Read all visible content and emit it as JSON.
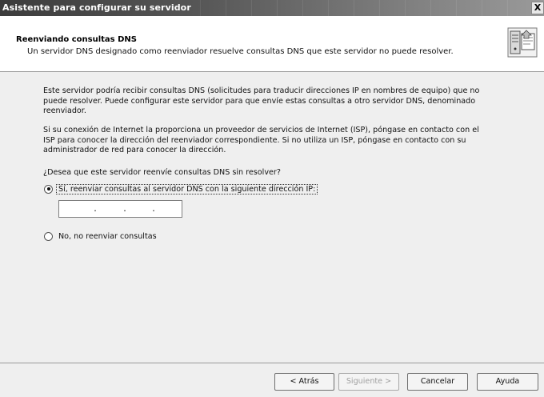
{
  "window": {
    "title": "Asistente para configurar su servidor",
    "close_glyph": "X"
  },
  "header": {
    "title": "Reenviando consultas DNS",
    "subtitle": "Un servidor DNS designado como reenviador resuelve consultas DNS que este servidor no puede resolver.",
    "icon": "server-wizard-icon"
  },
  "body": {
    "paragraph1": "Este servidor podría recibir consultas DNS (solicitudes para traducir direcciones IP en nombres de equipo) que no puede resolver. Puede configurar este servidor para que envíe estas consultas a otro servidor DNS, denominado reenviador.",
    "paragraph2": "Si su conexión de Internet la proporciona un proveedor de servicios de Internet (ISP), póngase en contacto con el ISP para conocer la dirección del reenviador correspondiente. Si no utiliza un ISP, póngase en contacto con su administrador de red para conocer la dirección.",
    "question": "¿Desea que este servidor reenvíe consultas DNS sin resolver?",
    "option_yes": "Sí, reenviar consultas al servidor DNS con la siguiente dirección IP:",
    "option_yes_checked": true,
    "ip_address": {
      "value": "",
      "separators": [
        ".",
        ".",
        "."
      ]
    },
    "option_no": "No, no reenviar consultas",
    "option_no_checked": false
  },
  "footer": {
    "back_label": "< Atrás",
    "next_label": "Siguiente >",
    "next_enabled": false,
    "cancel_label": "Cancelar",
    "help_label": "Ayuda"
  }
}
